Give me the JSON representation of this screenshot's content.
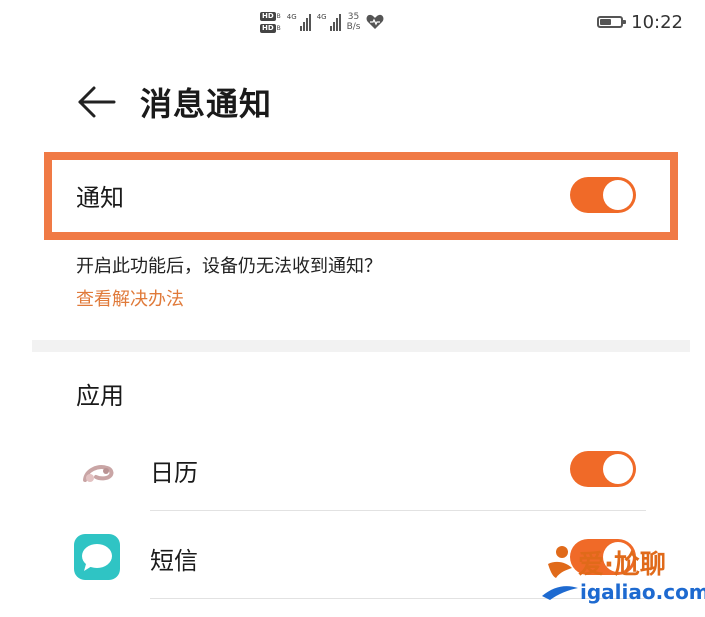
{
  "status_bar": {
    "hd_badge": "HD",
    "hd_sub": "B",
    "network_type_1": "4G",
    "network_type_2": "4G",
    "speed_value": "35",
    "speed_unit": "B/s",
    "time": "10:22",
    "battery_level": 0.55,
    "icons": [
      "hd-icon",
      "signal-icon",
      "heart-health-icon",
      "battery-icon"
    ]
  },
  "header": {
    "title": "消息通知",
    "back_icon": "back-arrow-icon"
  },
  "notification": {
    "label": "通知",
    "enabled": true,
    "hint": "开启此功能后，设备仍无法收到通知？",
    "link": "查看解决办法"
  },
  "apps_section": {
    "title": "应用",
    "items": [
      {
        "name": "日历",
        "icon": "calendar-app-icon",
        "enabled": true
      },
      {
        "name": "短信",
        "icon": "messages-app-icon",
        "enabled": true
      }
    ]
  },
  "watermark": {
    "top_text": "爱·尬聊",
    "bottom_text": "igaliao.com"
  },
  "colors": {
    "accent": "#f06a28",
    "highlight_border": "#f07a45",
    "link": "#e07a3a",
    "messages_icon": "#2fc4c4",
    "divider": "#f2f2f2"
  }
}
